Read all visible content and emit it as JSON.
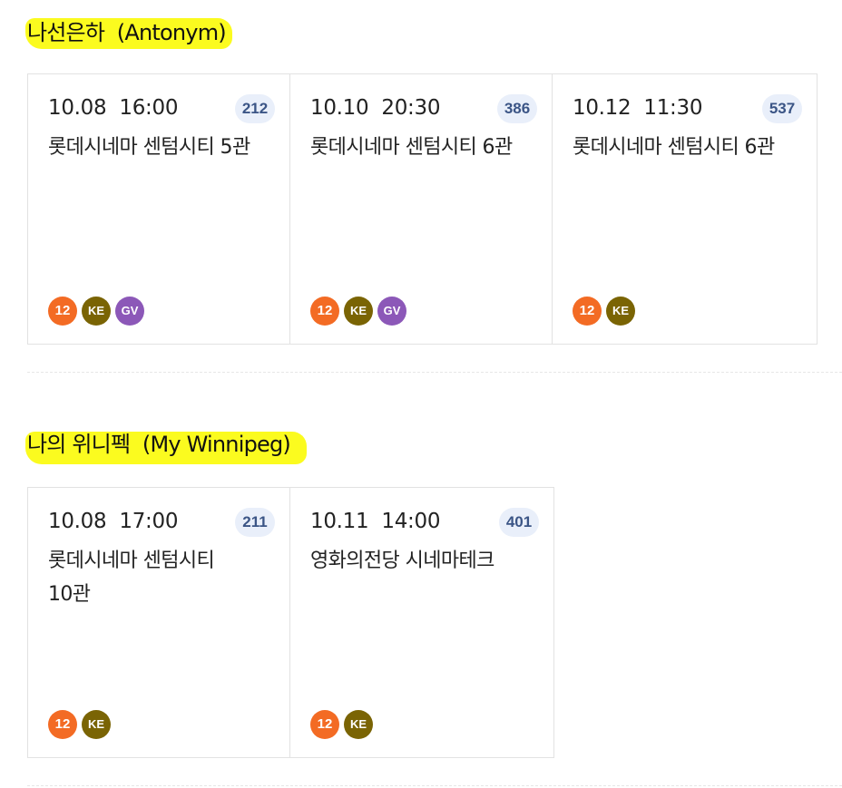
{
  "films": [
    {
      "title": "나선은하",
      "title_en": "(Antonym)",
      "screenings": [
        {
          "date": "10.08",
          "time": "16:00",
          "code": "212",
          "venue": "롯데시네마 센텀시티 5관",
          "badges": [
            {
              "label": "12",
              "color": "#f36b24",
              "icon": "age-12-badge"
            },
            {
              "label": "KE",
              "color": "#7a6404",
              "icon": "ke-badge"
            },
            {
              "label": "GV",
              "color": "#8c58b8",
              "icon": "gv-badge"
            }
          ]
        },
        {
          "date": "10.10",
          "time": "20:30",
          "code": "386",
          "venue": "롯데시네마 센텀시티 6관",
          "badges": [
            {
              "label": "12",
              "color": "#f36b24",
              "icon": "age-12-badge"
            },
            {
              "label": "KE",
              "color": "#7a6404",
              "icon": "ke-badge"
            },
            {
              "label": "GV",
              "color": "#8c58b8",
              "icon": "gv-badge"
            }
          ]
        },
        {
          "date": "10.12",
          "time": "11:30",
          "code": "537",
          "venue": "롯데시네마 센텀시티 6관",
          "badges": [
            {
              "label": "12",
              "color": "#f36b24",
              "icon": "age-12-badge"
            },
            {
              "label": "KE",
              "color": "#7a6404",
              "icon": "ke-badge"
            }
          ]
        }
      ]
    },
    {
      "title": "나의 위니펙",
      "title_en": "(My Winnipeg)",
      "screenings": [
        {
          "date": "10.08",
          "time": "17:00",
          "code": "211",
          "venue": "롯데시네마 센텀시티 10관",
          "badges": [
            {
              "label": "12",
              "color": "#f36b24",
              "icon": "age-12-badge"
            },
            {
              "label": "KE",
              "color": "#7a6404",
              "icon": "ke-badge"
            }
          ]
        },
        {
          "date": "10.11",
          "time": "14:00",
          "code": "401",
          "venue": "영화의전당 시네마테크",
          "badges": [
            {
              "label": "12",
              "color": "#f36b24",
              "icon": "age-12-badge"
            },
            {
              "label": "KE",
              "color": "#7a6404",
              "icon": "ke-badge"
            }
          ]
        }
      ]
    }
  ],
  "colors": {
    "highlight": "#fbfb1f",
    "code_bg": "#e9effa",
    "code_text": "#3b5586"
  }
}
